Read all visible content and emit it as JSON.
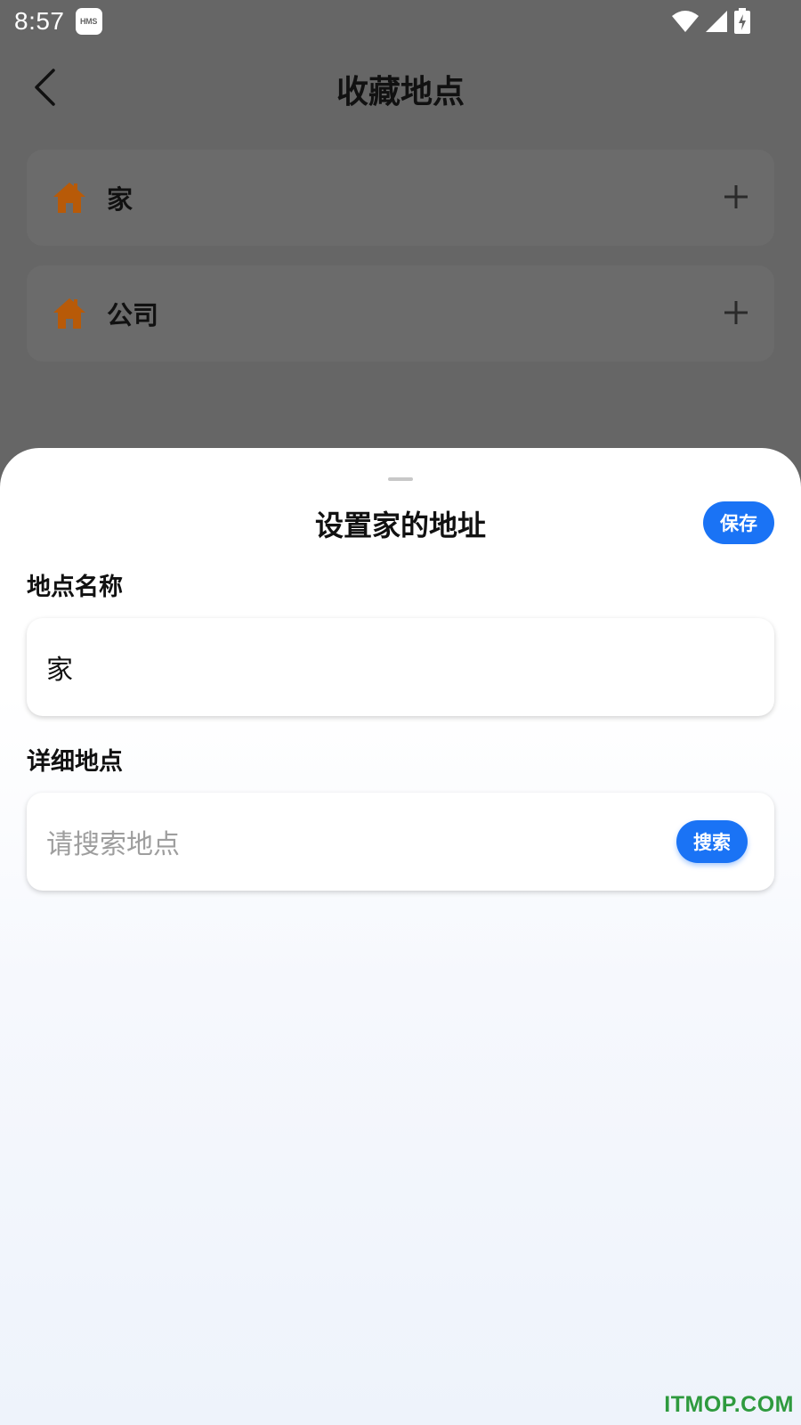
{
  "status_bar": {
    "time": "8:57",
    "badge": "HMS",
    "icons": [
      "wifi-icon",
      "cellular-signal-icon",
      "battery-charging-icon"
    ]
  },
  "header": {
    "title": "收藏地点",
    "back_icon": "chevron-left-icon"
  },
  "places": [
    {
      "label": "家",
      "icon": "home-icon",
      "action_icon": "plus-icon"
    },
    {
      "label": "公司",
      "icon": "home-icon",
      "action_icon": "plus-icon"
    }
  ],
  "sheet": {
    "title": "设置家的地址",
    "save_label": "保存",
    "name_field": {
      "label": "地点名称",
      "value": "家"
    },
    "address_field": {
      "label": "详细地点",
      "placeholder": "请搜索地点",
      "search_label": "搜索"
    }
  },
  "watermark": "ITMOP.COM",
  "colors": {
    "accent": "#1a73f5",
    "overlay": "#666666",
    "home_icon": "#b85a08",
    "watermark": "#2e9a3e"
  }
}
